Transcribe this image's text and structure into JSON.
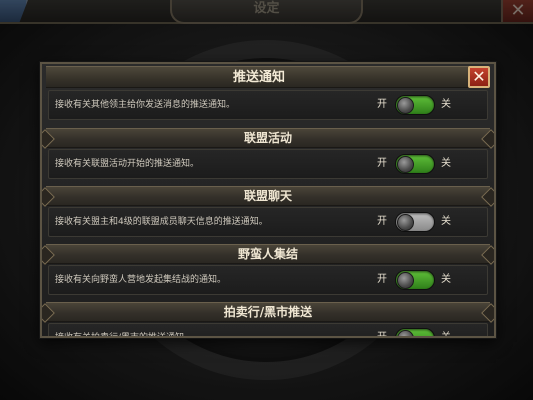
{
  "top_bar": {
    "title": "设定",
    "close_glyph": "✕"
  },
  "dialog": {
    "close_glyph": "✕",
    "sections": [
      {
        "title": "推送通知",
        "description": "接收有关其他领主给你发送消息的推送通知。",
        "on_label": "开",
        "off_label": "关",
        "enabled": true
      },
      {
        "title": "联盟活动",
        "description": "接收有关联盟活动开始的推送通知。",
        "on_label": "开",
        "off_label": "关",
        "enabled": true
      },
      {
        "title": "联盟聊天",
        "description": "接收有关盟主和4级的联盟成员聊天信息的推送通知。",
        "on_label": "开",
        "off_label": "关",
        "enabled": false
      },
      {
        "title": "野蛮人集结",
        "description": "接收有关向野蛮人营地发起集结战的通知。",
        "on_label": "开",
        "off_label": "关",
        "enabled": true
      },
      {
        "title": "拍卖行/黑市推送",
        "description": "接收有关拍卖行/黑市的推送通知。",
        "on_label": "开",
        "off_label": "关",
        "enabled": true
      }
    ]
  },
  "colors": {
    "toggle_on": "#4aa82c",
    "toggle_off": "#a8a8a8",
    "close_red": "#b0351f"
  }
}
